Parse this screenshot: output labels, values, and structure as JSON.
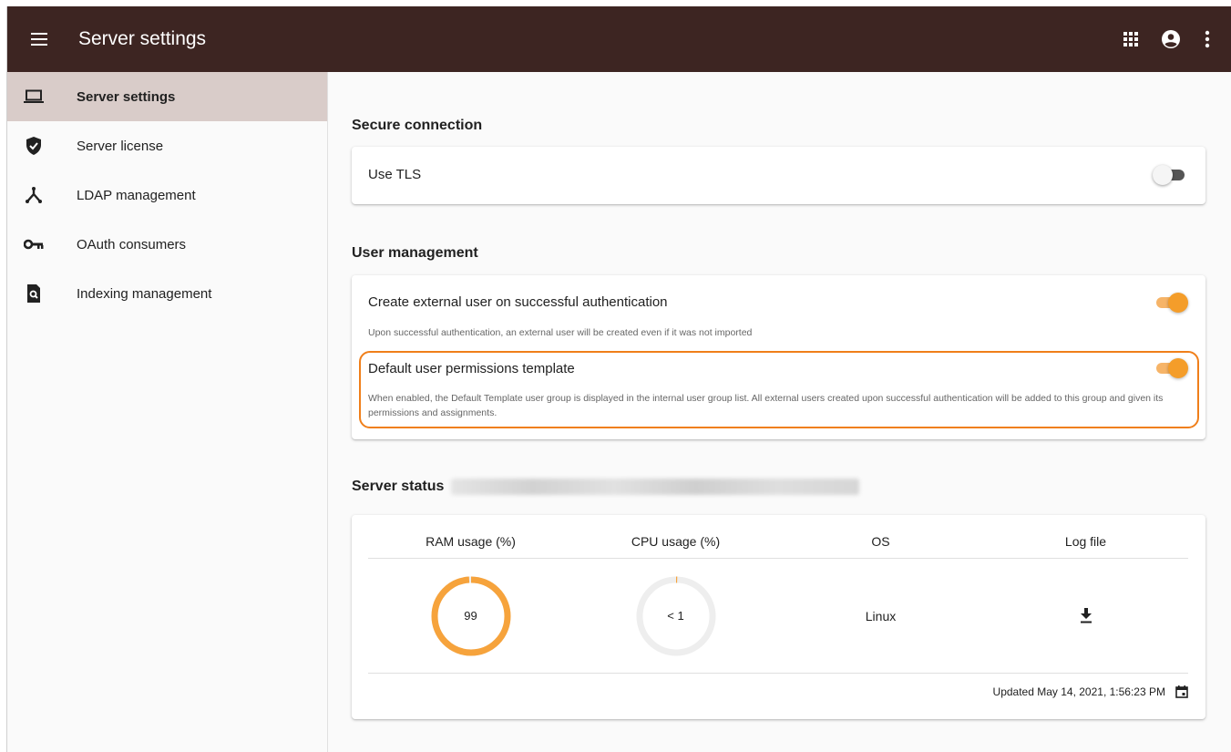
{
  "app": {
    "title": "Server settings"
  },
  "topbar": {
    "icons": [
      "menu-icon",
      "apps-grid-icon",
      "account-circle-icon",
      "more-vert-icon"
    ]
  },
  "sidebar": {
    "items": [
      {
        "label": "Server settings",
        "icon": "laptop-icon",
        "active": true
      },
      {
        "label": "Server license",
        "icon": "shield-check-icon",
        "active": false
      },
      {
        "label": "LDAP management",
        "icon": "hub-icon",
        "active": false
      },
      {
        "label": "OAuth consumers",
        "icon": "key-icon",
        "active": false
      },
      {
        "label": "Indexing management",
        "icon": "search-file-icon",
        "active": false
      }
    ]
  },
  "secure_connection": {
    "title": "Secure connection",
    "use_tls": {
      "label": "Use TLS",
      "enabled": false
    }
  },
  "user_management": {
    "title": "User management",
    "create_external": {
      "label": "Create external user on successful authentication",
      "help": "Upon successful authentication, an external user will be created even if it was not imported",
      "enabled": true
    },
    "default_template": {
      "label": "Default user permissions template",
      "help": "When enabled, the Default Template user group is displayed in the internal user group list. All external users created upon successful authentication will be added to this group and given its permissions and assignments.",
      "enabled": true
    }
  },
  "server_status": {
    "title": "Server status",
    "columns": [
      "RAM usage (%)",
      "CPU usage (%)",
      "OS",
      "Log file"
    ],
    "ram": {
      "value": 99,
      "label": "99"
    },
    "cpu": {
      "value": 1,
      "label": "< 1"
    },
    "os": "Linux",
    "log_icon": "download-icon",
    "updated": "Updated May 14, 2021, 1:56:23 PM",
    "calendar_icon": "calendar-icon"
  },
  "colors": {
    "topbar": "#3d2522",
    "active_nav": "#d9ccc9",
    "accent": "#f49d2a",
    "highlight": "#f07f1a"
  }
}
